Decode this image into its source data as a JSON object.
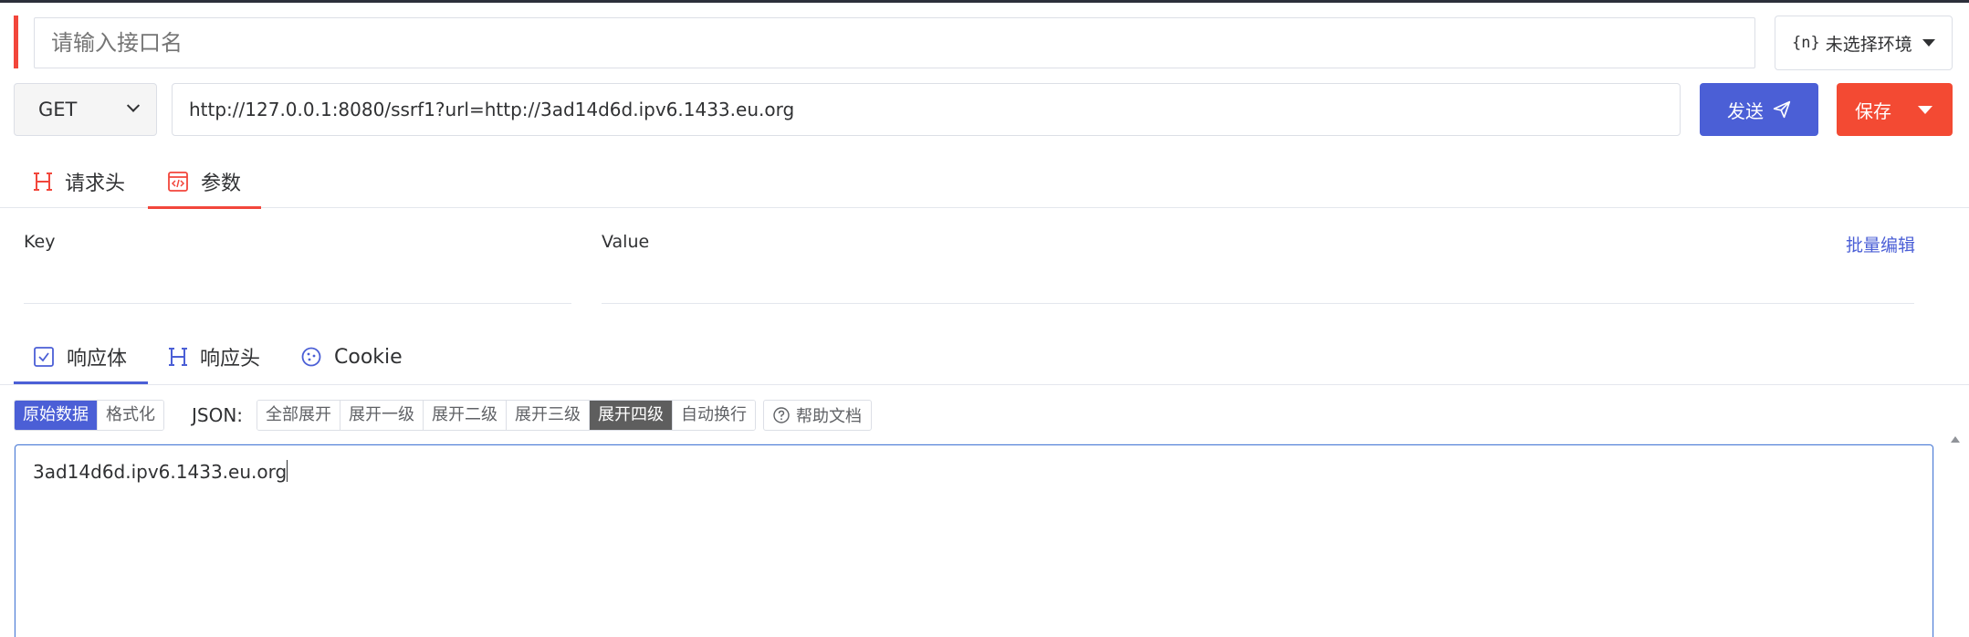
{
  "request": {
    "name_placeholder": "请输入接口名",
    "env": {
      "icon": "{n}",
      "label": "未选择环境"
    },
    "method": "GET",
    "url": "http://127.0.0.1:8080/ssrf1?url=http://3ad14d6d.ipv6.1433.eu.org",
    "send_label": "发送",
    "save_label": "保存"
  },
  "request_tabs": [
    {
      "label": "请求头",
      "icon": "h-icon"
    },
    {
      "label": "参数",
      "icon": "code-window-icon",
      "active": true
    }
  ],
  "params": {
    "key_header": "Key",
    "value_header": "Value",
    "bulk_edit_label": "批量编辑"
  },
  "response_tabs": [
    {
      "label": "响应体",
      "icon": "checkbox-icon",
      "active": true
    },
    {
      "label": "响应头",
      "icon": "h-icon"
    },
    {
      "label": "Cookie",
      "icon": "cookie-icon"
    }
  ],
  "toolbar": {
    "view_modes": [
      {
        "label": "原始数据",
        "selected": true
      },
      {
        "label": "格式化",
        "selected": false
      }
    ],
    "json_label": "JSON:",
    "json_buttons": [
      {
        "label": "全部展开",
        "selected": false
      },
      {
        "label": "展开一级",
        "selected": false
      },
      {
        "label": "展开二级",
        "selected": false
      },
      {
        "label": "展开三级",
        "selected": false
      },
      {
        "label": "展开四级",
        "selected": true
      },
      {
        "label": "自动换行",
        "selected": false
      }
    ],
    "help_label": "帮助文档"
  },
  "response_body": "3ad14d6d.ipv6.1433.eu.org",
  "colors": {
    "accent_blue": "#4b5fd6",
    "accent_red": "#f2463b",
    "save_red": "#f34a33"
  }
}
